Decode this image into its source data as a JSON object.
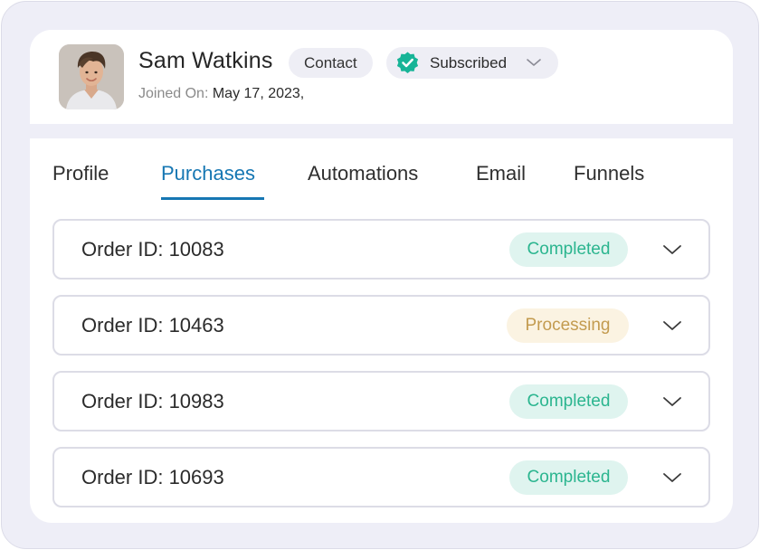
{
  "contact": {
    "name": "Sam Watkins",
    "type_label": "Contact",
    "status_label": "Subscribed",
    "joined_label": "Joined On:",
    "joined_value": "May 17, 2023,",
    "colors": {
      "subscribed_check": "#17b497"
    }
  },
  "tabs": [
    {
      "label": "Profile",
      "active": false
    },
    {
      "label": "Purchases",
      "active": true
    },
    {
      "label": "Automations",
      "active": false
    },
    {
      "label": "Email",
      "active": false
    },
    {
      "label": "Funnels",
      "active": false
    }
  ],
  "orders": [
    {
      "label": "Order ID: 10083",
      "status": "Completed",
      "status_type": "completed"
    },
    {
      "label": "Order ID: 10463",
      "status": "Processing",
      "status_type": "processing"
    },
    {
      "label": "Order ID: 10983",
      "status": "Completed",
      "status_type": "completed"
    },
    {
      "label": "Order ID: 10693",
      "status": "Completed",
      "status_type": "completed"
    }
  ],
  "colors": {
    "accent": "#1677b3",
    "completed_text": "#2bb58f",
    "completed_bg": "#dff4ef",
    "processing_text": "#c39b4f",
    "processing_bg": "#fbf3e2",
    "page_bg": "#eeeef7"
  },
  "icons": {
    "subscribed": "verified-badge-check-icon",
    "dropdown": "chevron-down-icon"
  }
}
